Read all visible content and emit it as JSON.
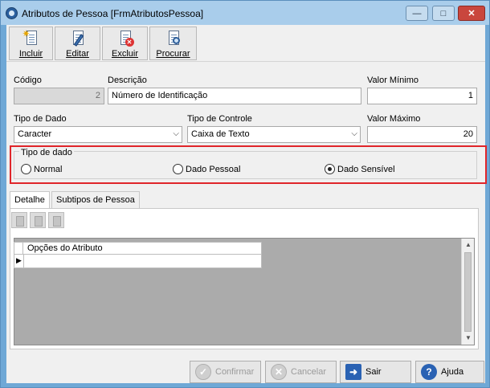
{
  "window": {
    "title": "Atributos de Pessoa [FrmAtributosPessoa]",
    "min_glyph": "—",
    "max_glyph": "□",
    "close_glyph": "✕"
  },
  "toolbar": {
    "incluir": "Incluir",
    "editar": "Editar",
    "excluir": "Excluir",
    "procurar": "Procurar"
  },
  "form": {
    "codigo_label": "Código",
    "codigo_value": "2",
    "descricao_label": "Descrição",
    "descricao_value": "Número de Identificação",
    "valor_minimo_label": "Valor Mínimo",
    "valor_minimo_value": "1",
    "tipo_dado_label": "Tipo de Dado",
    "tipo_dado_value": "Caracter",
    "tipo_controle_label": "Tipo de Controle",
    "tipo_controle_value": "Caixa de Texto",
    "valor_maximo_label": "Valor Máximo",
    "valor_maximo_value": "20"
  },
  "tipo_de_dado_group": {
    "title": "Tipo de dado",
    "options": [
      "Normal",
      "Dado Pessoal",
      "Dado Sensível"
    ],
    "selected": "Dado Sensível"
  },
  "tabs": [
    "Detalhe",
    "Subtipos de Pessoa"
  ],
  "active_tab": "Detalhe",
  "grid": {
    "columns": [
      "Opções do Atributo"
    ],
    "row_indicator": "▶"
  },
  "buttons": {
    "confirmar": "Confirmar",
    "cancelar": "Cancelar",
    "sair": "Sair",
    "ajuda": "Ajuda"
  },
  "colors": {
    "highlight_frame": "#e0252a",
    "title_bar": "#a9cdeb",
    "button_icon_blue": "#2a62b3"
  }
}
